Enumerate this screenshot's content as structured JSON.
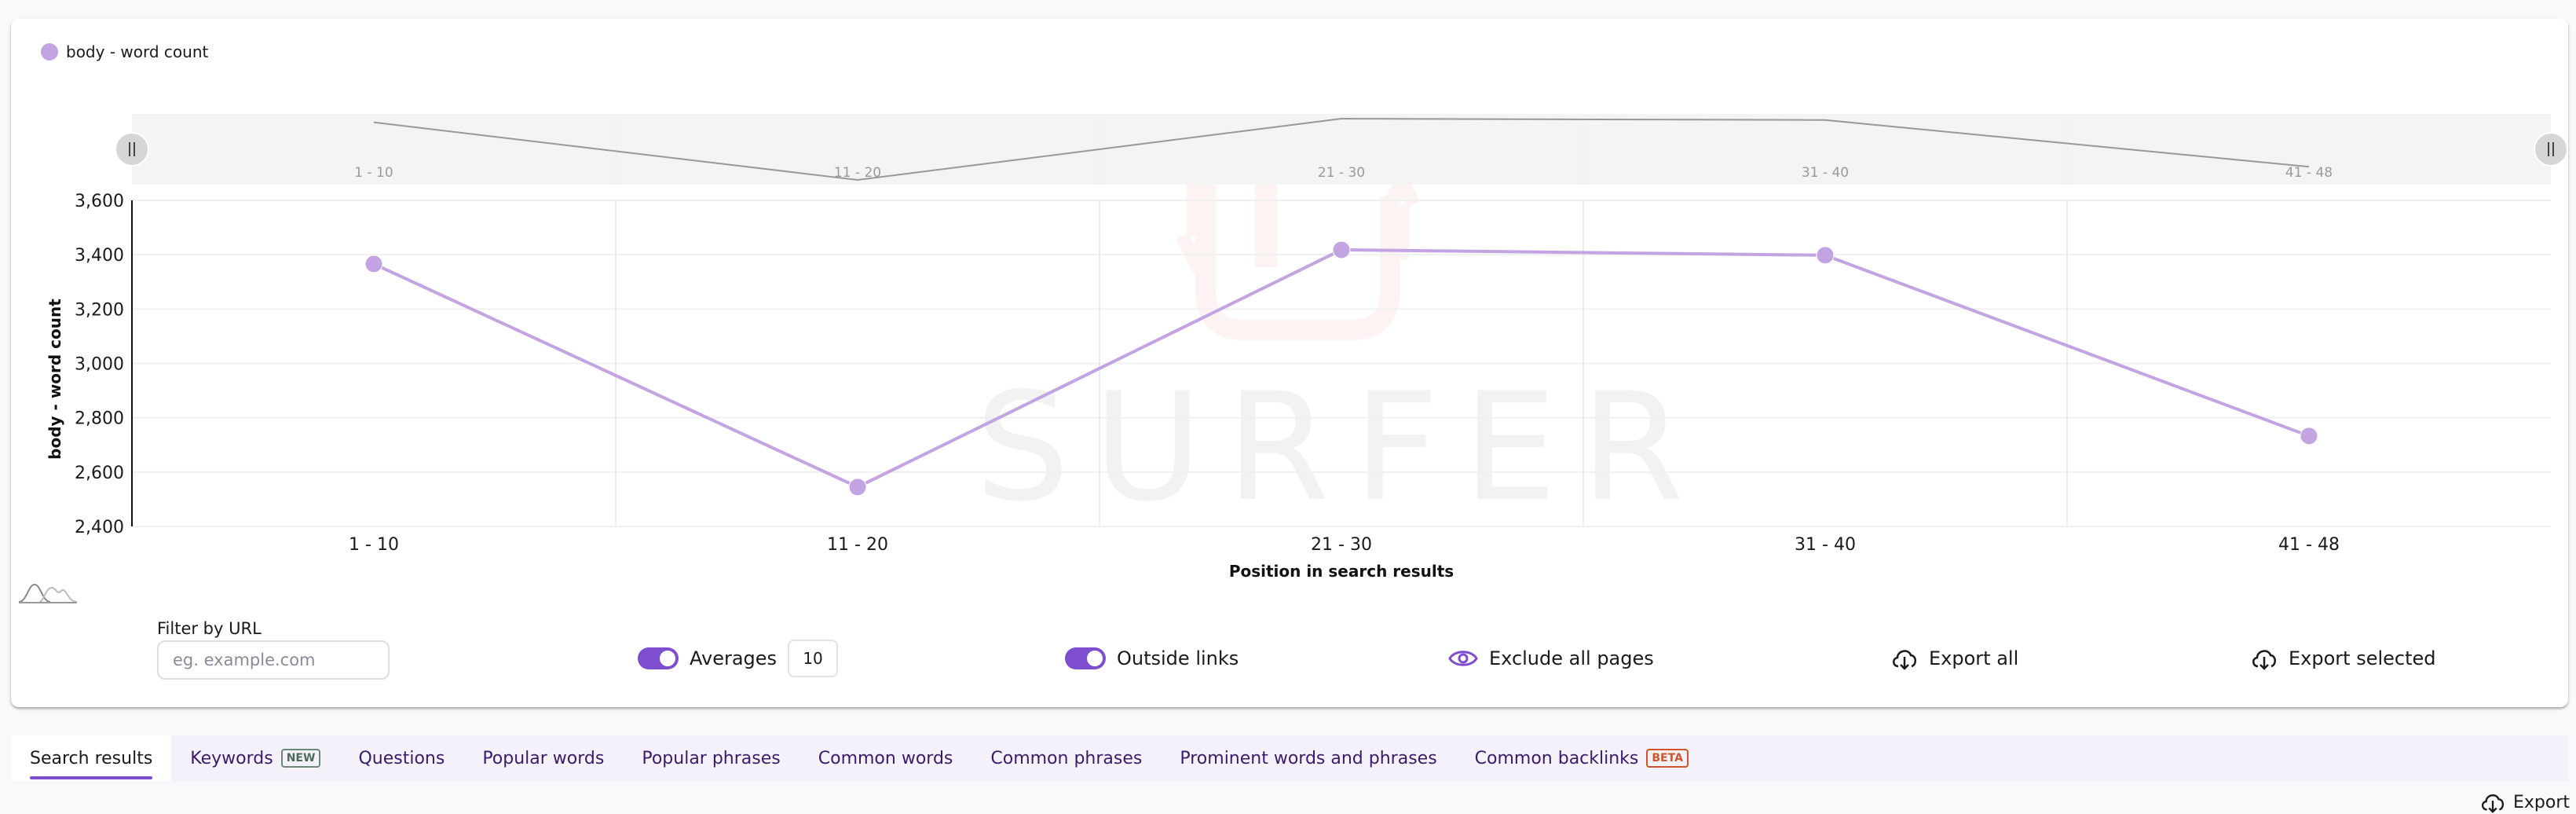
{
  "legend": {
    "label": "body - word count",
    "color": "#c3a4e3"
  },
  "chart_data": {
    "type": "line",
    "title": "",
    "xlabel": "Position in search results",
    "ylabel": "body - word count",
    "categories": [
      "1 - 10",
      "11 - 20",
      "21 - 30",
      "31 - 40",
      "41 - 48"
    ],
    "series": [
      {
        "name": "body - word count",
        "color": "#c3a4e3",
        "values": [
          3366,
          2545,
          3418,
          3398,
          2733
        ]
      }
    ],
    "ylim": [
      2400,
      3600
    ],
    "yticks": [
      2400,
      2600,
      2800,
      3000,
      3200,
      3400,
      3600
    ],
    "ytick_labels": [
      "2,400",
      "2,600",
      "2,800",
      "3,000",
      "3,200",
      "3,400",
      "3,600"
    ],
    "grid": true,
    "legend_position": "top-left",
    "navigator": {
      "categories": [
        "1 - 10",
        "11 - 20",
        "21 - 30",
        "31 - 40",
        "41 - 48"
      ]
    },
    "watermark": "SURFER"
  },
  "controls": {
    "filter_label": "Filter by URL",
    "filter_placeholder": "eg. example.com",
    "filter_value": "",
    "averages_label": "Averages",
    "averages_on": true,
    "averages_value": "10",
    "outside_links_label": "Outside links",
    "outside_links_on": true,
    "exclude_all_label": "Exclude all pages",
    "export_all_label": "Export all",
    "export_selected_label": "Export selected"
  },
  "tabs": [
    {
      "label": "Search results",
      "active": true
    },
    {
      "label": "Keywords",
      "badge": "NEW"
    },
    {
      "label": "Questions"
    },
    {
      "label": "Popular words"
    },
    {
      "label": "Popular phrases"
    },
    {
      "label": "Common words"
    },
    {
      "label": "Common phrases"
    },
    {
      "label": "Prominent words and phrases"
    },
    {
      "label": "Common backlinks",
      "badge": "BETA"
    }
  ],
  "export_label": "Export"
}
